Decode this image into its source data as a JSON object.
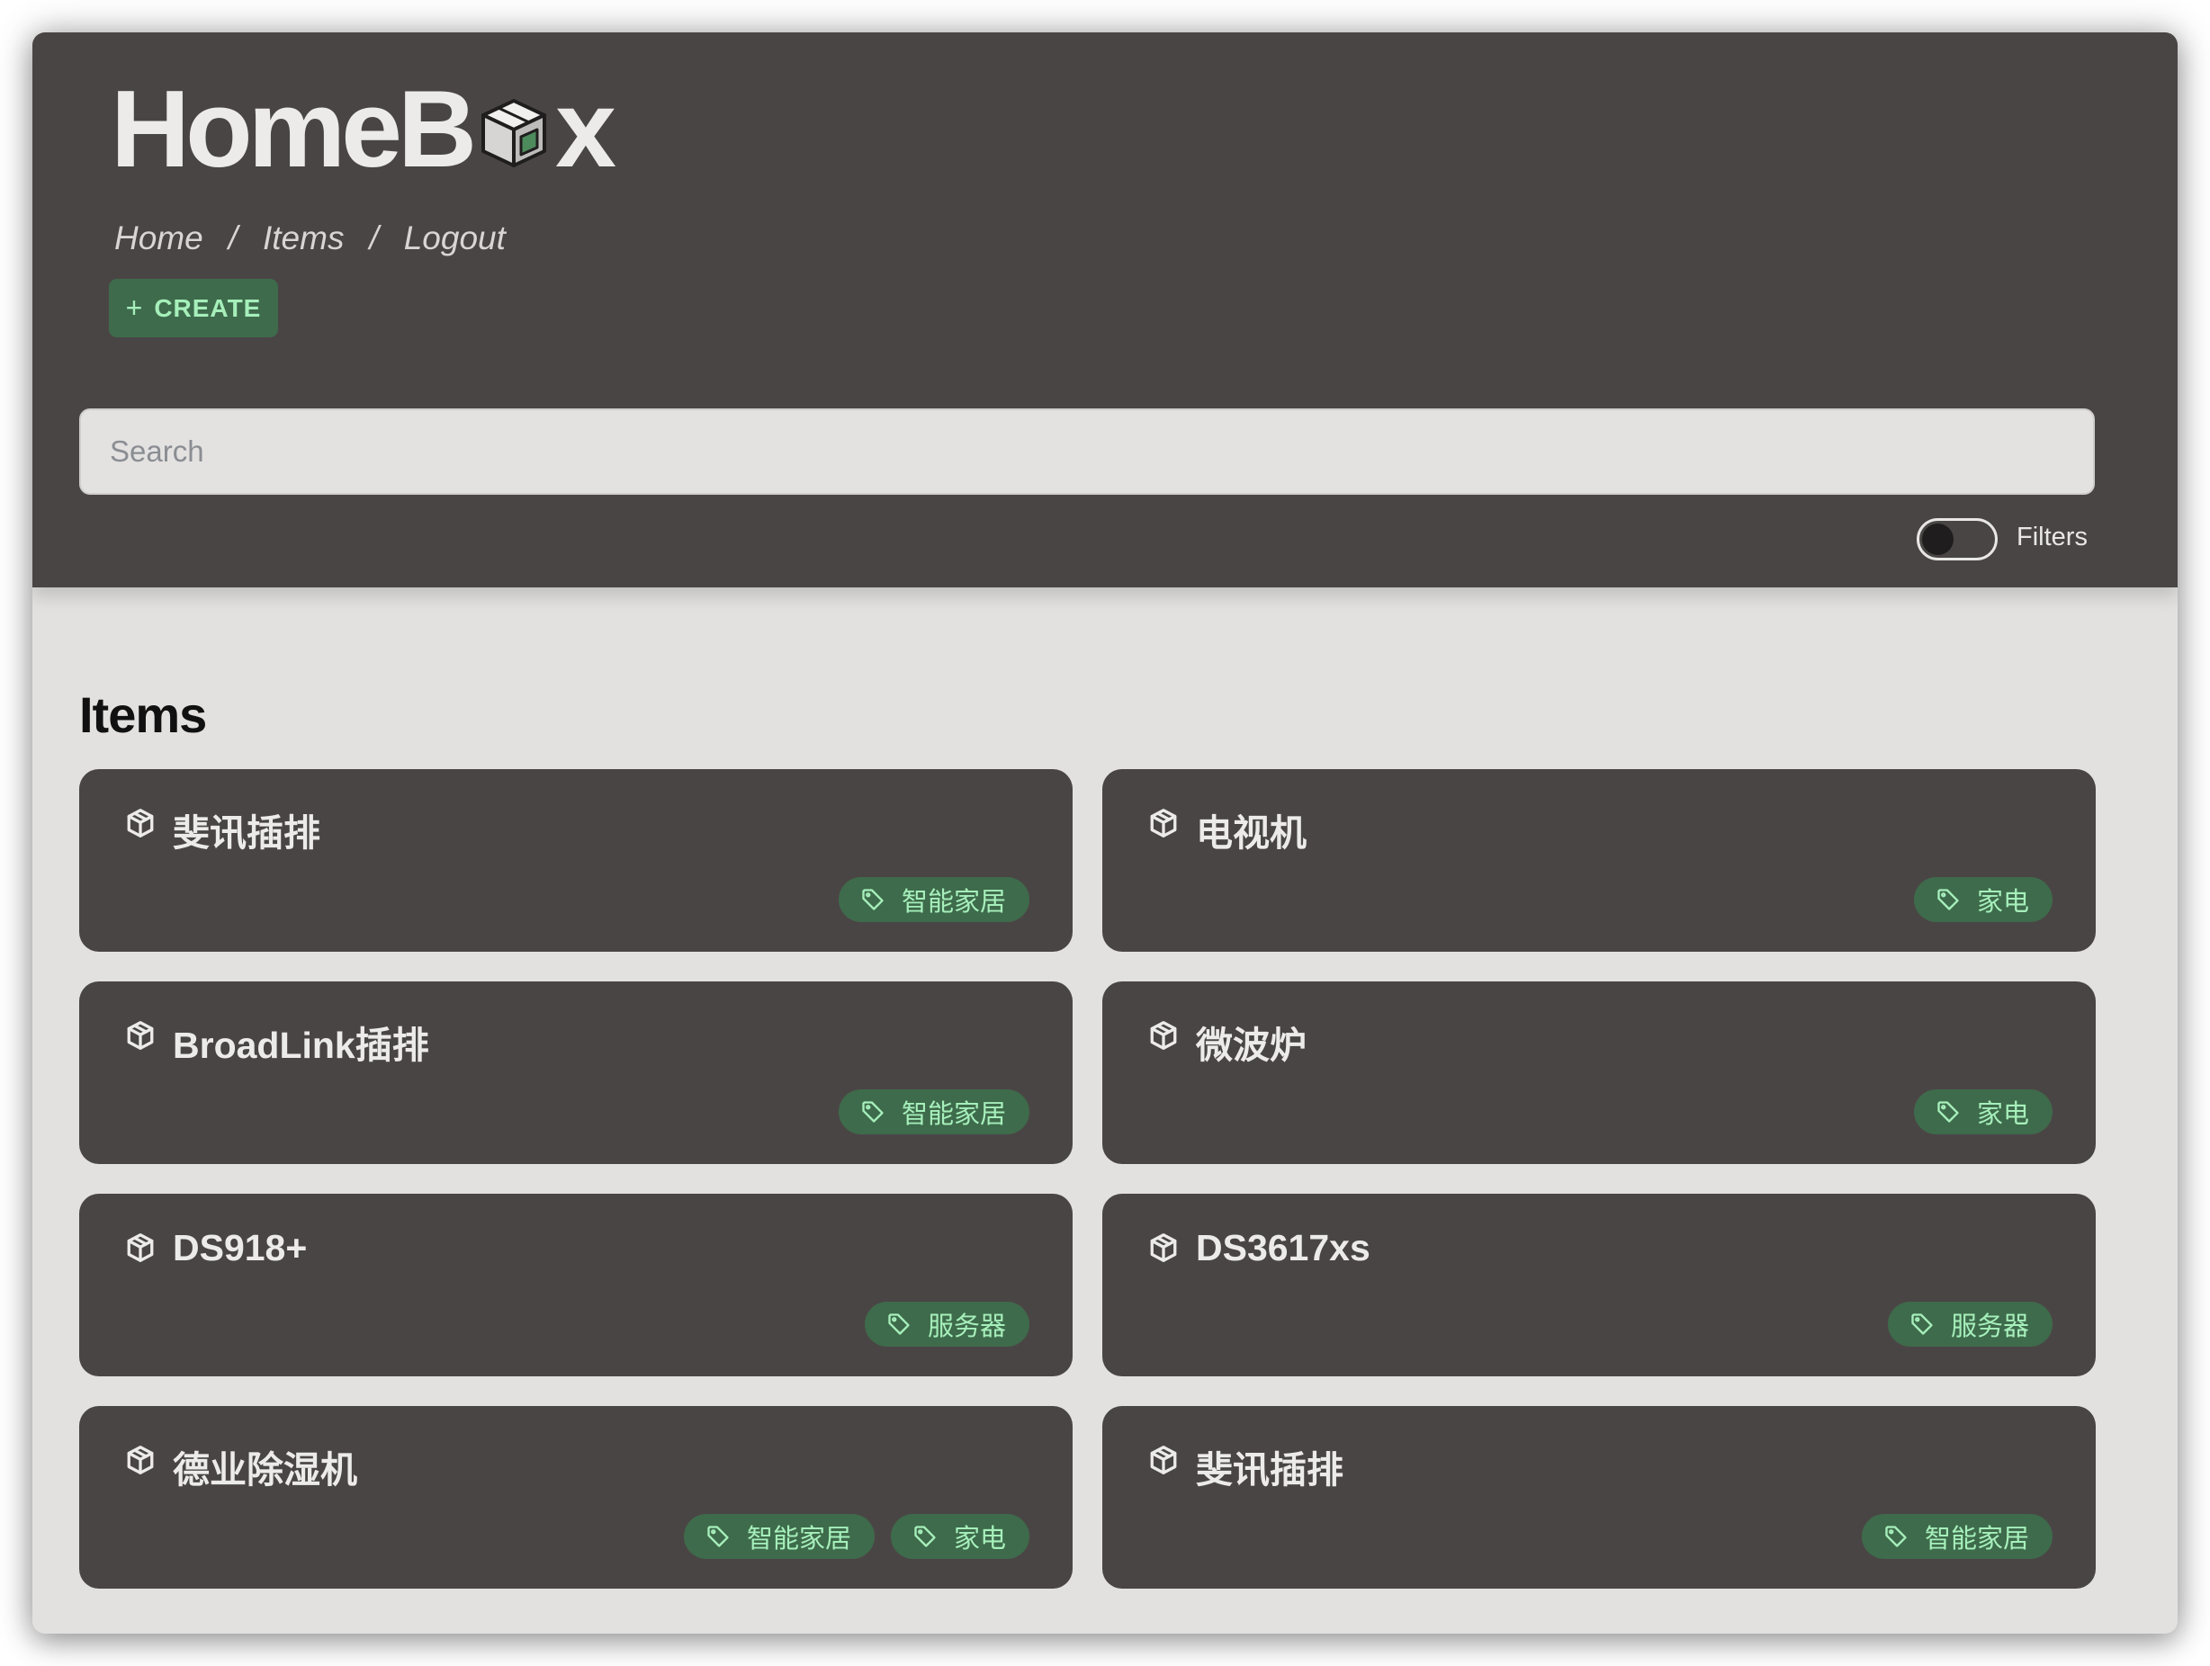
{
  "app": {
    "logo_text_left": "HomeB",
    "logo_text_right": "x",
    "logo_icon": "box-icon"
  },
  "breadcrumb": {
    "items": [
      "Home",
      "Items",
      "Logout"
    ],
    "separator": "/"
  },
  "toolbar": {
    "create_plus": "+",
    "create_label": "CREATE"
  },
  "search": {
    "placeholder": "Search",
    "value": ""
  },
  "filters": {
    "label": "Filters",
    "enabled": false
  },
  "main": {
    "title": "Items",
    "items": [
      {
        "name": "斐讯插排",
        "tags": [
          "智能家居"
        ]
      },
      {
        "name": "电视机",
        "tags": [
          "家电"
        ]
      },
      {
        "name": "BroadLink插排",
        "tags": [
          "智能家居"
        ]
      },
      {
        "name": "微波炉",
        "tags": [
          "家电"
        ]
      },
      {
        "name": "DS918+",
        "tags": [
          "服务器"
        ]
      },
      {
        "name": "DS3617xs",
        "tags": [
          "服务器"
        ]
      },
      {
        "name": "德业除湿机",
        "tags": [
          "智能家居",
          "家电"
        ]
      },
      {
        "name": "斐讯插排",
        "tags": [
          "智能家居"
        ]
      }
    ]
  },
  "icons": {
    "item": "cube-icon",
    "tag": "tag-icon"
  },
  "colors": {
    "header_bg": "#4a4545",
    "page_bg": "#e2e1e0",
    "card_bg": "#4a4545",
    "accent_bg": "#3e6b4b",
    "accent_text": "#a6efbb"
  }
}
